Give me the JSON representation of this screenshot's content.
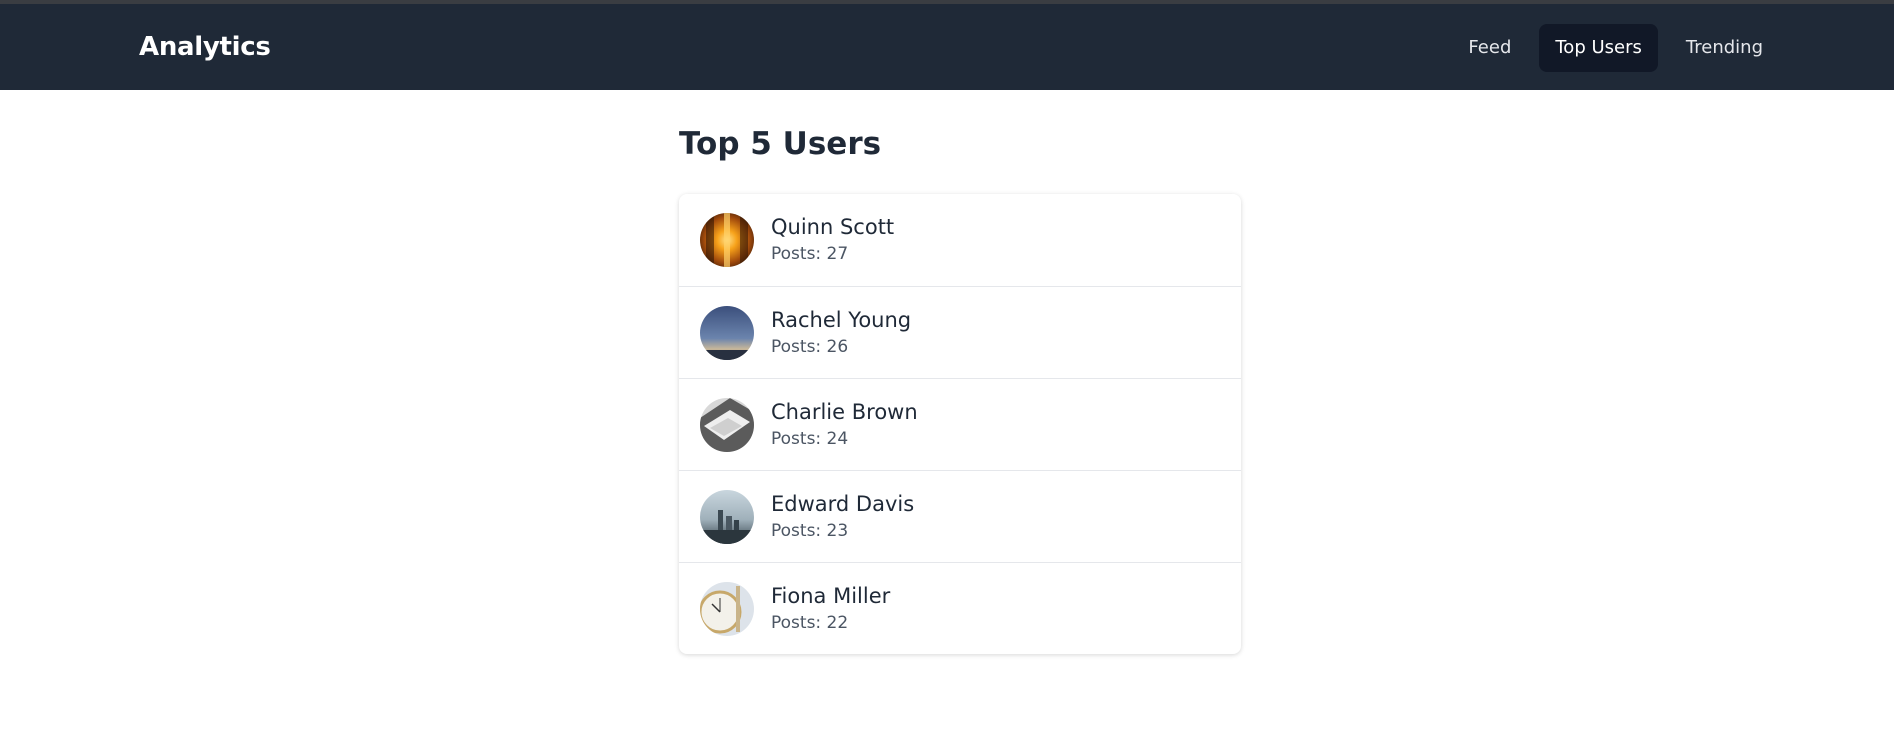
{
  "header": {
    "brand": "Analytics",
    "nav": [
      {
        "label": "Feed",
        "active": false
      },
      {
        "label": "Top Users",
        "active": true
      },
      {
        "label": "Trending",
        "active": false
      }
    ]
  },
  "main": {
    "title": "Top 5 Users",
    "users": [
      {
        "name": "Quinn Scott",
        "posts": "Posts: 27"
      },
      {
        "name": "Rachel Young",
        "posts": "Posts: 26"
      },
      {
        "name": "Charlie Brown",
        "posts": "Posts: 24"
      },
      {
        "name": "Edward Davis",
        "posts": "Posts: 23"
      },
      {
        "name": "Fiona Miller",
        "posts": "Posts: 22"
      }
    ]
  },
  "colors": {
    "header_bg": "#1f2937",
    "active_nav_bg": "#111827",
    "text_primary": "#1f2937",
    "text_secondary": "#4b5563"
  }
}
